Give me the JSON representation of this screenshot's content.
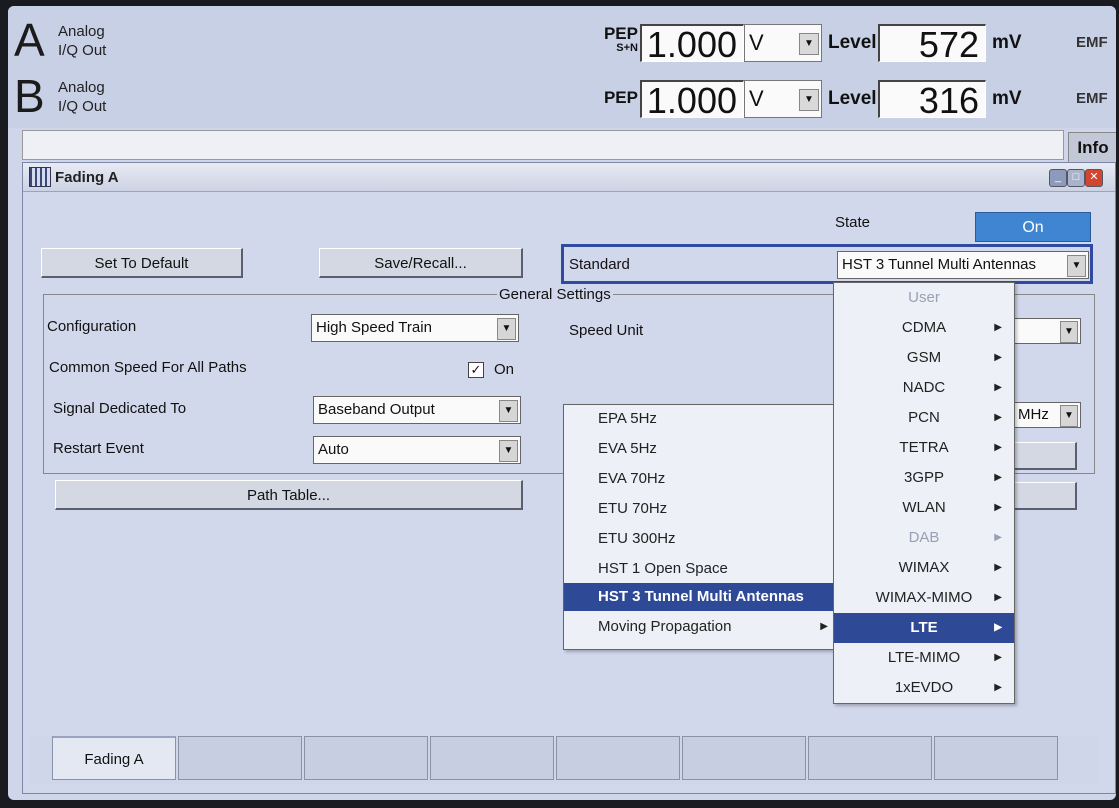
{
  "status": {
    "path_a": {
      "letter": "A",
      "name_line1": "Analog",
      "name_line2": "I/Q Out",
      "pep_label": "PEP",
      "pep_sub": "S+N",
      "pep_value": "1.000",
      "pep_unit": "V",
      "level_label": "Level",
      "level_value": "572",
      "level_unit": "mV",
      "emf": "EMF"
    },
    "path_b": {
      "letter": "B",
      "name_line1": "Analog",
      "name_line2": "I/Q Out",
      "pep_label": "PEP",
      "pep_sub": "",
      "pep_value": "1.000",
      "pep_unit": "V",
      "level_label": "Level",
      "level_value": "316",
      "level_unit": "mV",
      "emf": "EMF"
    },
    "info_button": "Info",
    "info_text": ""
  },
  "window": {
    "title": "Fading A",
    "state_label": "State",
    "state_value": "On",
    "set_default": "Set To Default",
    "save_recall": "Save/Recall...",
    "standard_label": "Standard",
    "standard_value": "HST 3 Tunnel Multi Antennas",
    "group_title": "General Settings",
    "configuration_label": "Configuration",
    "configuration_value": "High Speed Train",
    "common_speed_label": "Common Speed For All Paths",
    "common_speed_check": "✓",
    "common_speed_value": "On",
    "signal_label": "Signal Dedicated To",
    "signal_value": "Baseband Output",
    "restart_label": "Restart Event",
    "restart_value": "Auto",
    "speed_unit_label": "Speed Unit",
    "path_table": "Path Table...",
    "freq_unit": "MHz"
  },
  "submenu": {
    "items": [
      "EPA  5Hz",
      "EVA  5Hz",
      "EVA  70Hz",
      "ETU  70Hz",
      "ETU 300Hz",
      "HST 1 Open Space",
      "HST 3 Tunnel Multi Antennas",
      "Moving Propagation"
    ],
    "selected": "HST 3 Tunnel Multi Antennas"
  },
  "standards_menu": {
    "items": [
      "User",
      "CDMA",
      "GSM",
      "NADC",
      "PCN",
      "TETRA",
      "3GPP",
      "WLAN",
      "DAB",
      "WIMAX",
      "WIMAX-MIMO",
      "LTE",
      "LTE-MIMO",
      "1xEVDO"
    ],
    "selected": "LTE"
  },
  "tabs": [
    "Fading A",
    "",
    "",
    "",
    "",
    "",
    "",
    ""
  ]
}
